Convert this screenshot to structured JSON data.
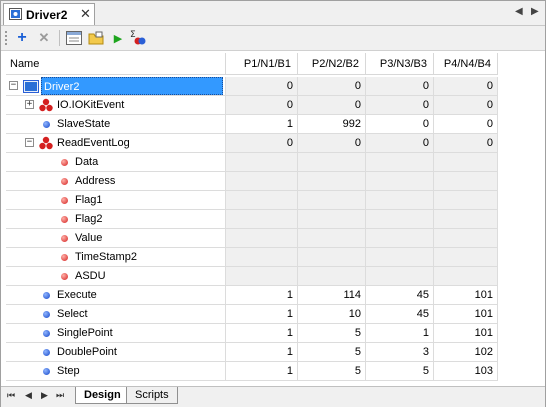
{
  "document_tab": {
    "title": "Driver2",
    "close": "✕"
  },
  "nav": {
    "prev": "◀",
    "next": "▶"
  },
  "toolbar": {
    "items": [
      {
        "name": "add-icon",
        "glyph": "+"
      },
      {
        "name": "delete-icon",
        "glyph": "✕"
      },
      {
        "name": "properties-icon"
      },
      {
        "name": "folder-icon"
      },
      {
        "name": "run-icon",
        "glyph": "▶"
      },
      {
        "name": "sum-icon",
        "glyph": "Σ"
      }
    ]
  },
  "grid": {
    "columns": [
      "Name",
      "P1/N1/B1",
      "P2/N2/B2",
      "P3/N3/B3",
      "P4/N4/B4"
    ],
    "rows": [
      {
        "label": "Driver2",
        "values": [
          "0",
          "0",
          "0",
          "0"
        ]
      },
      {
        "label": "IO.IOKitEvent",
        "values": [
          "0",
          "0",
          "0",
          "0"
        ]
      },
      {
        "label": "SlaveState",
        "values": [
          "1",
          "992",
          "0",
          "0"
        ]
      },
      {
        "label": "ReadEventLog",
        "values": [
          "0",
          "0",
          "0",
          "0"
        ]
      },
      {
        "label": "Data",
        "values": [
          "",
          "",
          "",
          ""
        ]
      },
      {
        "label": "Address",
        "values": [
          "",
          "",
          "",
          ""
        ]
      },
      {
        "label": "Flag1",
        "values": [
          "",
          "",
          "",
          ""
        ]
      },
      {
        "label": "Flag2",
        "values": [
          "",
          "",
          "",
          ""
        ]
      },
      {
        "label": "Value",
        "values": [
          "",
          "",
          "",
          ""
        ]
      },
      {
        "label": "TimeStamp2",
        "values": [
          "",
          "",
          "",
          ""
        ]
      },
      {
        "label": "ASDU",
        "values": [
          "",
          "",
          "",
          ""
        ]
      },
      {
        "label": "Execute",
        "values": [
          "1",
          "114",
          "45",
          "101"
        ]
      },
      {
        "label": "Select",
        "values": [
          "1",
          "10",
          "45",
          "101"
        ]
      },
      {
        "label": "SinglePoint",
        "values": [
          "1",
          "5",
          "1",
          "101"
        ]
      },
      {
        "label": "DoublePoint",
        "values": [
          "1",
          "5",
          "3",
          "102"
        ]
      },
      {
        "label": "Step",
        "values": [
          "1",
          "5",
          "5",
          "103"
        ]
      }
    ]
  },
  "bottom_nav": {
    "first": "⏮",
    "prev": "◀",
    "next": "▶",
    "last": "⏭"
  },
  "bottom_tabs": {
    "design": "Design",
    "scripts": "Scripts"
  }
}
